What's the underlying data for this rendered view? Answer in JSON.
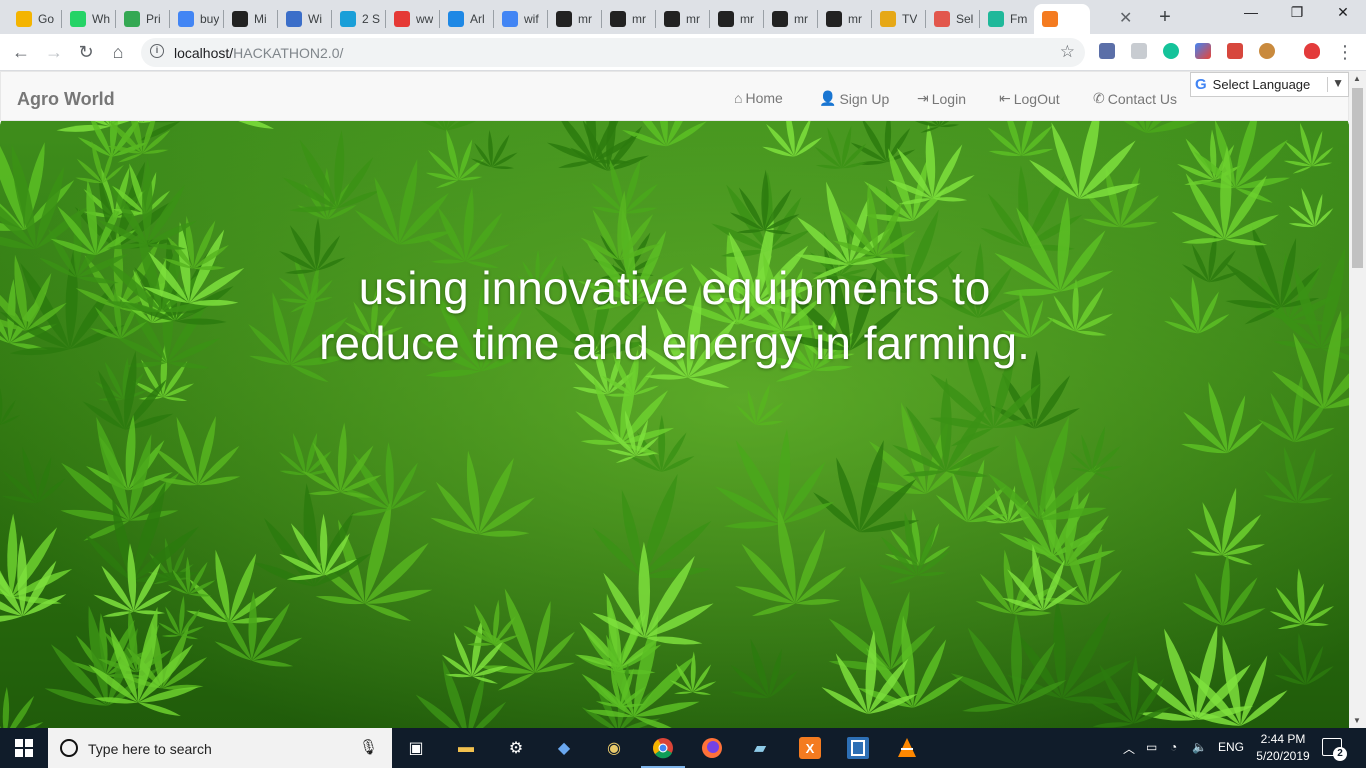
{
  "browser": {
    "tabs": [
      {
        "label": "Go",
        "icon": "bulb-icon",
        "color": "#f4b400"
      },
      {
        "label": "Wh",
        "icon": "whatsapp-icon",
        "color": "#25d366"
      },
      {
        "label": "Pri",
        "icon": "play-icon",
        "color": "#34a853"
      },
      {
        "label": "buy",
        "icon": "google-icon",
        "color": "#4285f4"
      },
      {
        "label": "Mi",
        "icon": "amazon-icon",
        "color": "#222222"
      },
      {
        "label": "Wi",
        "icon": "shield-icon",
        "color": "#3b6ec9"
      },
      {
        "label": "2 S",
        "icon": "chat-icon",
        "color": "#1a9fd8"
      },
      {
        "label": "ww",
        "icon": "w-icon",
        "color": "#e53935"
      },
      {
        "label": "Arl",
        "icon": "cloud-icon",
        "color": "#1e88e5"
      },
      {
        "label": "wif",
        "icon": "google-icon",
        "color": "#4285f4"
      },
      {
        "label": "mr",
        "icon": "github-icon",
        "color": "#222222"
      },
      {
        "label": "mr",
        "icon": "github-icon",
        "color": "#222222"
      },
      {
        "label": "mr",
        "icon": "github-icon",
        "color": "#222222"
      },
      {
        "label": "mr",
        "icon": "github-icon",
        "color": "#222222"
      },
      {
        "label": "mr",
        "icon": "github-icon",
        "color": "#222222"
      },
      {
        "label": "mr",
        "icon": "github-icon",
        "color": "#222222"
      },
      {
        "label": "TV",
        "icon": "tv-icon",
        "color": "#e6a817"
      },
      {
        "label": "Sel",
        "icon": "brave-icon",
        "color": "#e2574c"
      },
      {
        "label": "Fm",
        "icon": "play-circle-icon",
        "color": "#1fb89a"
      },
      {
        "label": "",
        "icon": "xampp-icon",
        "color": "#f47b20"
      }
    ],
    "url_host": "localhost/",
    "url_path": "HACKATHON2.0/"
  },
  "page": {
    "brand": "Agro World",
    "nav": [
      {
        "label": "Home",
        "icon": "home-icon"
      },
      {
        "label": "Sign Up",
        "icon": "user-icon"
      },
      {
        "label": "Login",
        "icon": "login-icon"
      },
      {
        "label": "LogOut",
        "icon": "logout-icon"
      },
      {
        "label": "Contact Us",
        "icon": "phone-icon"
      }
    ],
    "language_select": "Select Language",
    "hero_line1": "using innovative equipments to",
    "hero_line2": "reduce time and energy in farming."
  },
  "taskbar": {
    "search_placeholder": "Type here to search",
    "lang": "ENG",
    "time": "2:44 PM",
    "date": "5/20/2019",
    "notifications": "2"
  }
}
